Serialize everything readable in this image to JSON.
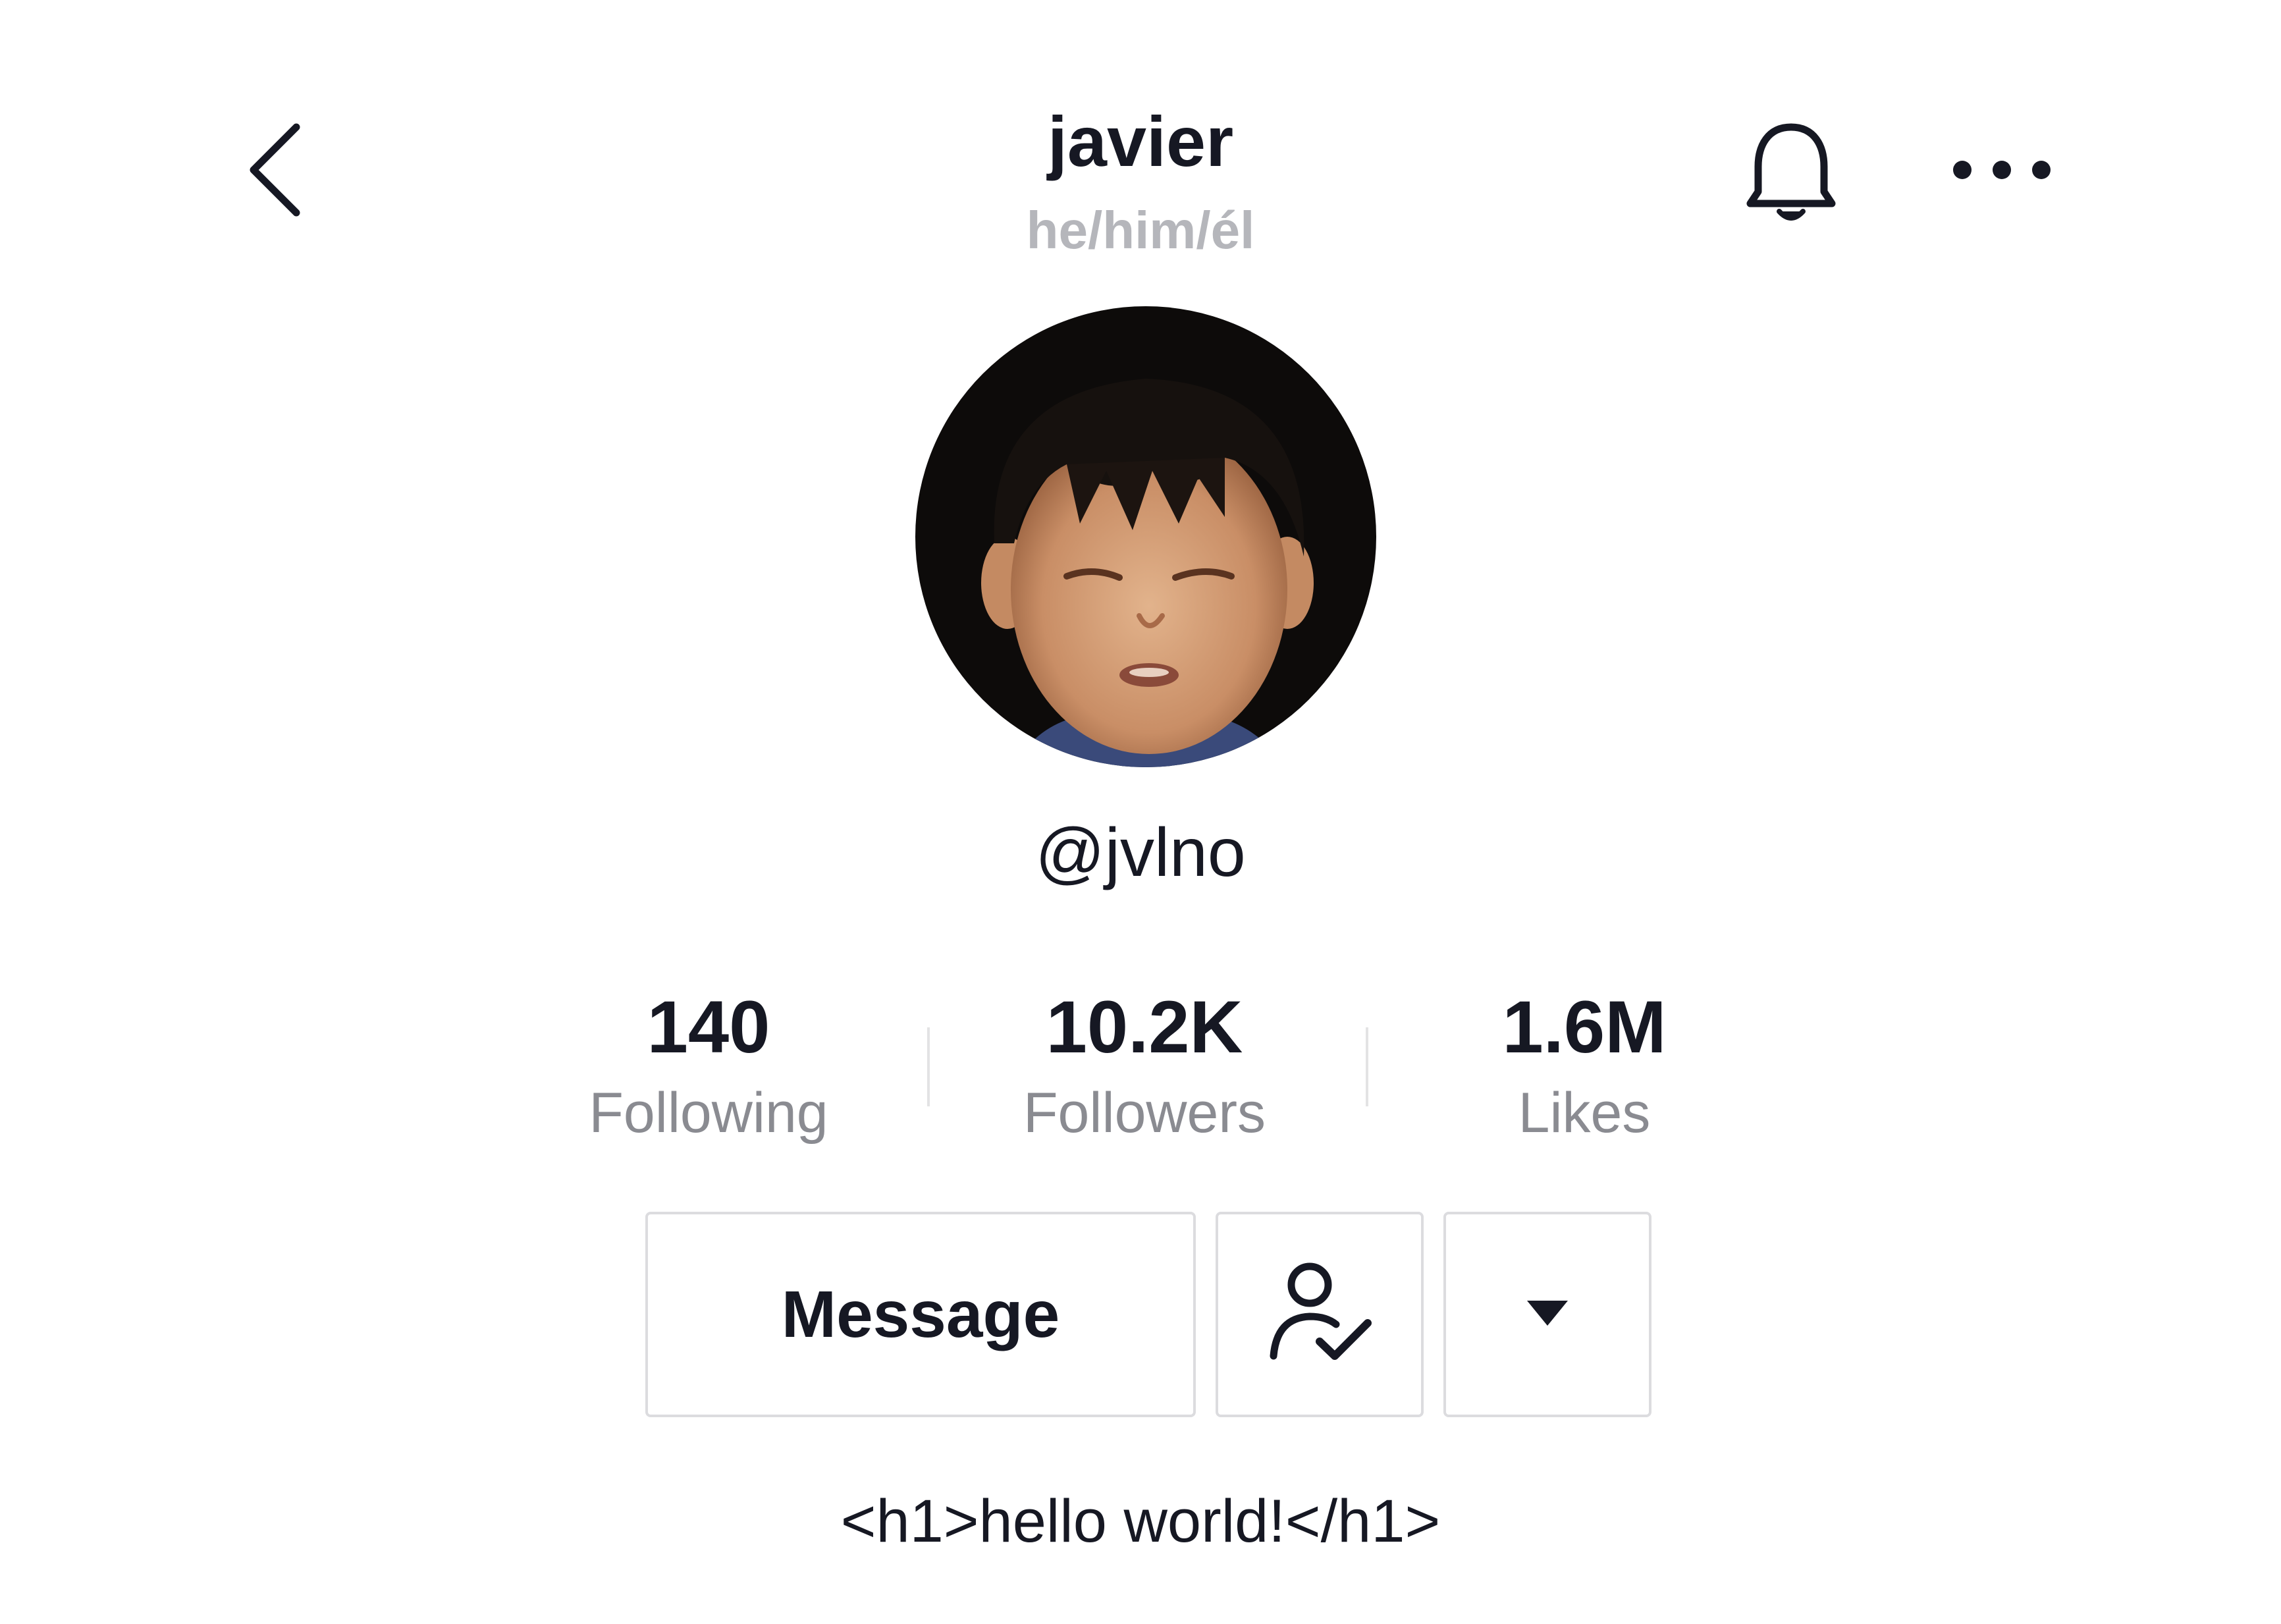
{
  "header": {
    "title": "javier",
    "pronouns": "he/him/él"
  },
  "profile": {
    "username": "@jvlno"
  },
  "stats": [
    {
      "value": "140",
      "label": "Following"
    },
    {
      "value": "10.2K",
      "label": "Followers"
    },
    {
      "value": "1.6M",
      "label": "Likes"
    }
  ],
  "actions": {
    "message_label": "Message"
  },
  "bio": "<h1>hello world!</h1>",
  "icons": {
    "back": "chevron-left-icon",
    "bell": "bell-icon",
    "more": "more-horizontal-icon",
    "following": "user-check-icon",
    "dropdown": "caret-down-icon"
  },
  "colors": {
    "text_primary": "#161823",
    "text_secondary": "#8a8b91",
    "pronouns": "#b5b6bb",
    "border": "#dcdcdf"
  }
}
